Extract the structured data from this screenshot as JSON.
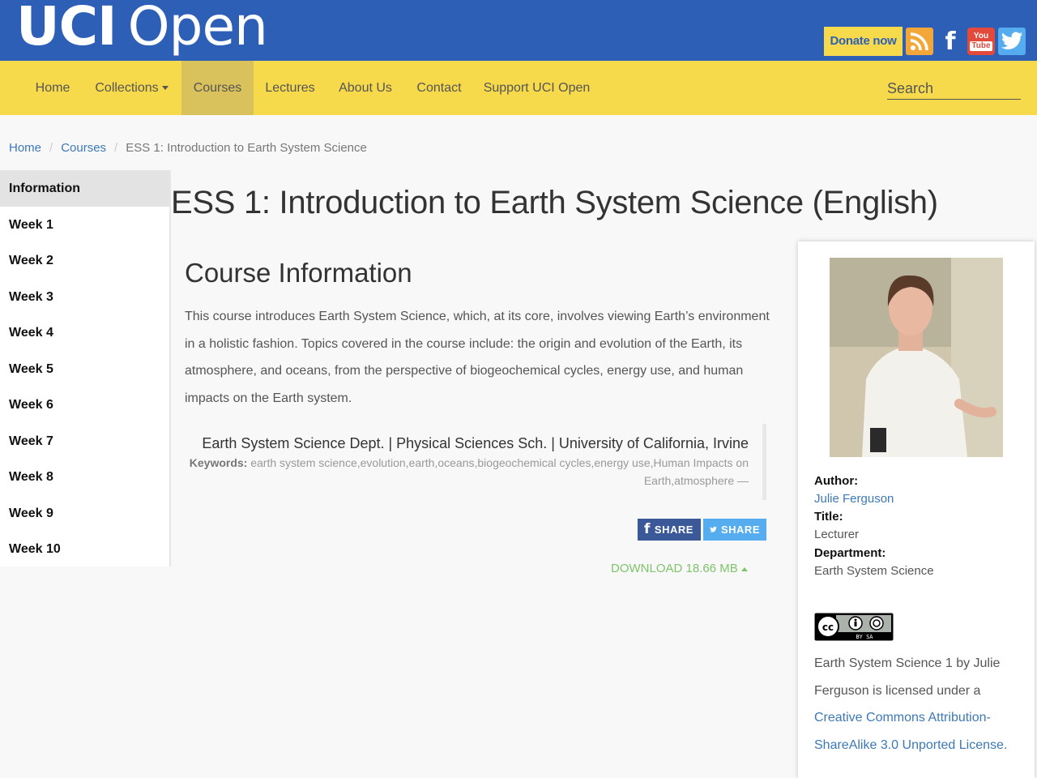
{
  "header": {
    "logo_bold": "UCI",
    "logo_light": "Open",
    "donate_label": "Donate now",
    "social_icons": [
      "rss-icon",
      "facebook-icon",
      "youtube-icon",
      "twitter-icon"
    ],
    "youtube_text_top": "You",
    "youtube_text_bottom": "Tube",
    "facebook_letter": "f"
  },
  "nav": {
    "items": [
      {
        "label": "Home"
      },
      {
        "label": "Collections"
      },
      {
        "label": "Courses",
        "active": true
      },
      {
        "label": "Lectures"
      },
      {
        "label": "About Us"
      },
      {
        "label": "Contact"
      },
      {
        "label": "Support UCI Open"
      }
    ],
    "search_placeholder": "Search"
  },
  "breadcrumb": {
    "home": "Home",
    "courses": "Courses",
    "current": "ESS 1: Introduction to Earth System Science",
    "separator": "/"
  },
  "sidebar": {
    "items": [
      "Information",
      "Week 1",
      "Week 2",
      "Week 3",
      "Week 4",
      "Week 5",
      "Week 6",
      "Week 7",
      "Week 8",
      "Week 9",
      "Week 10"
    ],
    "active_index": 0
  },
  "main": {
    "page_title": "ESS 1: Introduction to Earth System Science (English)",
    "section_title": "Course Information",
    "description": "This course introduces Earth System Science, which, at its core, involves viewing Earth’s environment in a holistic fashion. Topics covered in the course include: the origin and evolution of the Earth, its atmosphere, and oceans, from the perspective of biogeochemical cycles, energy use, and human impacts on the Earth system.",
    "department_line": "Earth System Science Dept. | Physical Sciences Sch. | University of California, Irvine",
    "keywords_label": "Keywords:",
    "keywords": "earth system science,evolution,earth,oceans,biogeochemical cycles,energy use,Human Impacts on Earth,atmosphere —",
    "share_facebook": "SHARE",
    "share_twitter": "SHARE",
    "download_label": "DOWNLOAD 18.66 MB"
  },
  "author_card": {
    "author_label": "Author:",
    "author_name": "Julie Ferguson",
    "title_label": "Title:",
    "title_value": "Lecturer",
    "department_label": "Department:",
    "department_value": "Earth System Science",
    "cc_badge_text": "BY   SA",
    "license_text": "Earth System Science 1 by Julie Ferguson is licensed under a ",
    "license_link": "Creative Commons Attribution-ShareAlike 3.0 Unported License."
  },
  "colors": {
    "header_blue": "#2d5fb7",
    "nav_yellow": "#f7d94c",
    "link_blue": "#3d78b7",
    "download_green": "#7ec46a"
  }
}
